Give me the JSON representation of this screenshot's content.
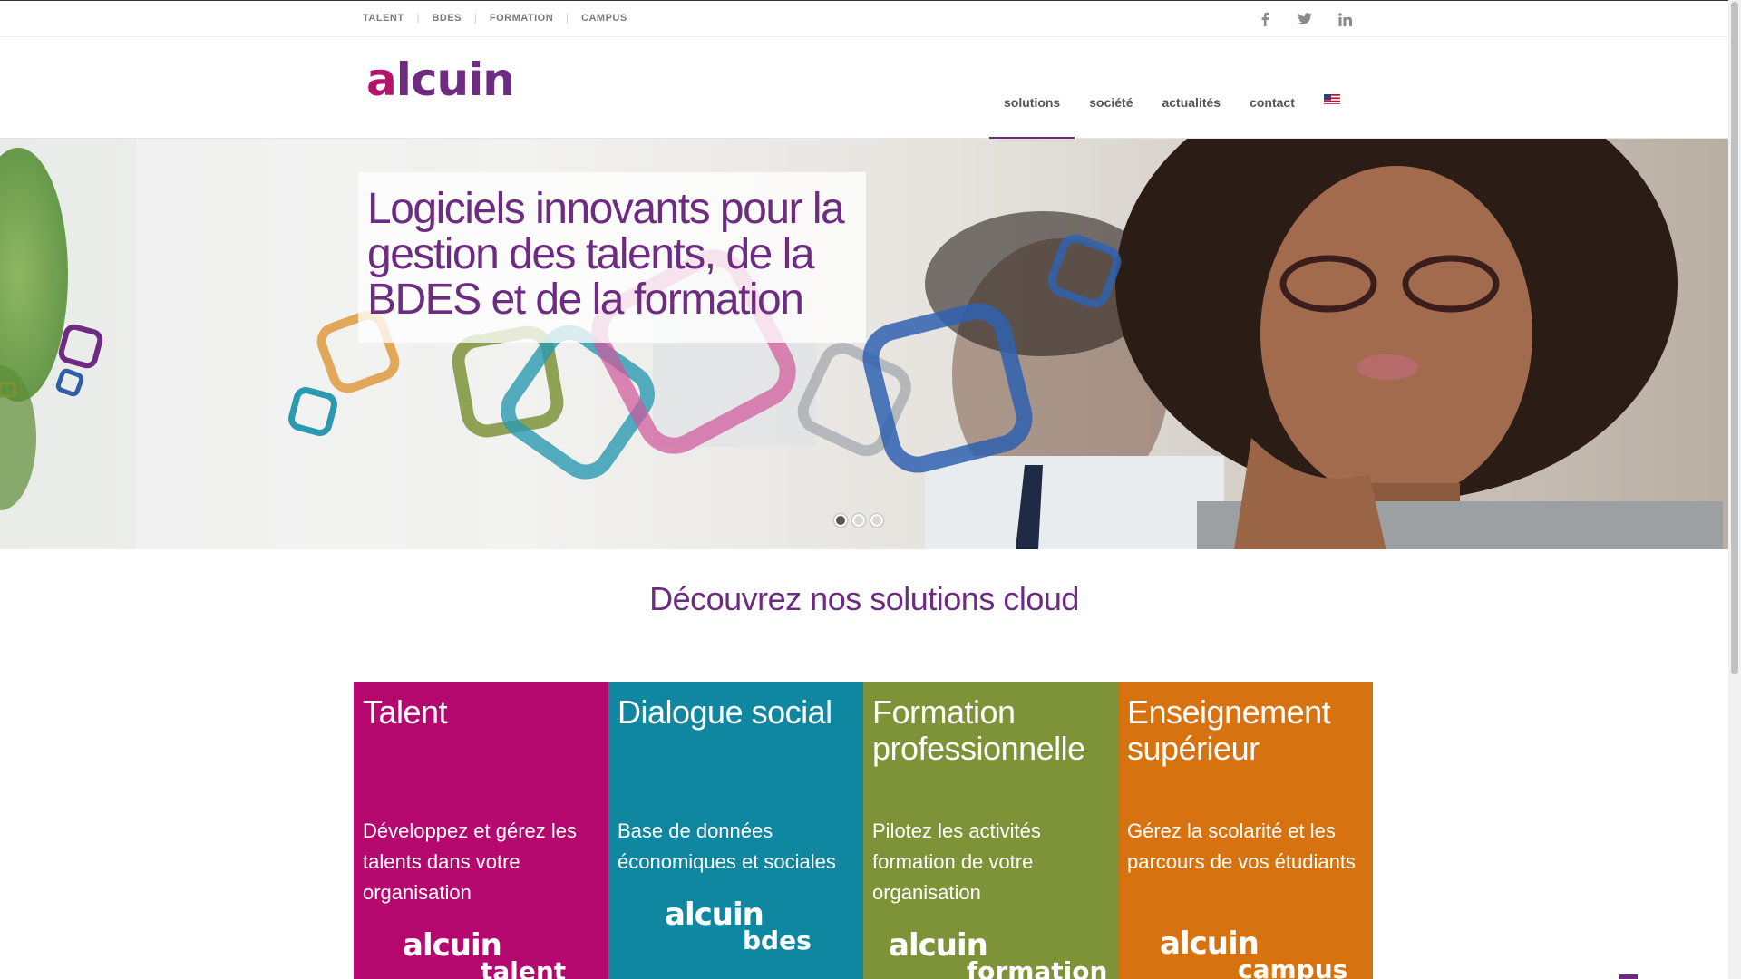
{
  "topbar": {
    "links": [
      "TALENT",
      "BDES",
      "FORMATION",
      "CAMPUS"
    ],
    "separator": "|",
    "social": [
      "facebook-icon",
      "twitter-icon",
      "linkedin-icon"
    ]
  },
  "header": {
    "logo_text": "alcuin",
    "nav": [
      "solutions",
      "société",
      "actualités",
      "contact"
    ],
    "active_nav": "solutions",
    "language_flag": "us-flag-icon"
  },
  "hero": {
    "headline": "Logiciels innovants pour la gestion des talents, de la BDES et de la formation",
    "slides": 3,
    "active_slide": 1
  },
  "solutions": {
    "title": "Découvrez nos solutions cloud",
    "cards": [
      {
        "title": "Talent",
        "description": "Développez et gérez les talents dans votre organisation",
        "logo_brand": "alcuin",
        "logo_sub": "talent",
        "color": "#b5086e"
      },
      {
        "title": "Dialogue social",
        "description": "Base de données économiques et sociales",
        "logo_brand": "alcuin",
        "logo_sub": "bdes",
        "color": "#0f87a0"
      },
      {
        "title": "Formation professionnelle",
        "description": "Pilotez les activités formation de votre organisation",
        "logo_brand": "alcuin",
        "logo_sub": "formation",
        "color": "#7e9338"
      },
      {
        "title": "Enseignement supérieur",
        "description": "Gérez la scolarité et les parcours de vos étudiants",
        "logo_brand": "alcuin",
        "logo_sub": "campus",
        "color": "#d6720f"
      }
    ]
  },
  "colors": {
    "brand_purple": "#6e2b82",
    "brand_magenta": "#b5146e"
  }
}
